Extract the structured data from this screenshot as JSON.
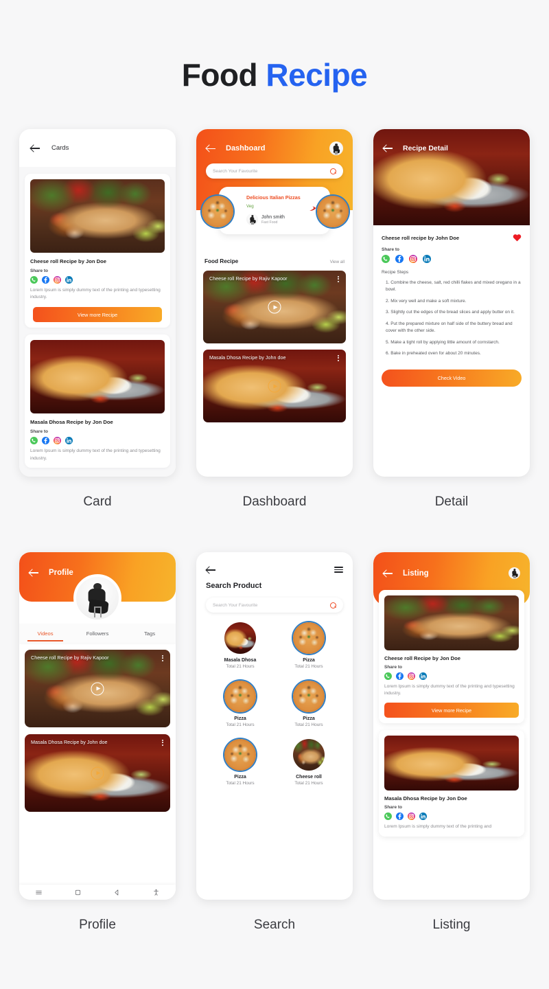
{
  "header": {
    "title_dark": "Food",
    "title_accent": "Recipe",
    "accent_color": "#2563f0"
  },
  "common": {
    "share_label": "Share to",
    "lorem": "Lorem Ipsum is simply dummy text of the printing and typesetting industry.",
    "view_more": "View more Recipe",
    "socials": [
      "whatsapp-icon",
      "facebook-icon",
      "instagram-icon",
      "linkedin-icon"
    ]
  },
  "screens": [
    {
      "caption": "Card",
      "title": "Cards",
      "cards": [
        {
          "title": "Cheese roll Recipe by Jon Doe",
          "share_label": "Share to",
          "text": "Lorem Ipsum is simply dummy text of the printing and typesetting industry.",
          "cta": "View more Recipe"
        },
        {
          "title": "Masala Dhosa Recipe by Jon Doe",
          "share_label": "Share to",
          "text": "Lorem Ipsum is simply dummy text of the printing and typesetting industry."
        }
      ]
    },
    {
      "caption": "Dashboard",
      "title": "Dashboard",
      "search_placeholder": "Search Your Favourite",
      "promo": {
        "title": "Delicious Italian Pizzas",
        "veg": "Veg",
        "chef_name": "John smith",
        "chef_role": "Fast Food"
      },
      "section": {
        "heading": "Food Recipe",
        "view_all": "View all"
      },
      "videos": [
        {
          "title": "Cheese roll Recipe by Rajiv Kapoor"
        },
        {
          "title": "Masala Dhosa Recipe by John doe"
        }
      ]
    },
    {
      "caption": "Detail",
      "title": "Recipe Detail",
      "recipe_title": "Cheese roll recipe by John Doe",
      "share_label": "Share to",
      "steps_label": "Recipe Steps",
      "steps": [
        "1. Combine the cheese, salt, red chilli flakes and mixed oregano in a bowl.",
        "2. Mix very well and make a soft mixture.",
        "3. Slightly cut the edges of the bread slices and apply butter on it.",
        "4. Put the prepared mixture on half side of the buttery bread and cover with the other side.",
        "5. Make a tight roll by applying little amount of cornstarch.",
        "6. Bake in preheated oven for about 20 minutes."
      ],
      "cta": "Check Video"
    },
    {
      "caption": "Profile",
      "title": "Profile",
      "tabs": [
        {
          "label": "Videos",
          "active": true
        },
        {
          "label": "Followers",
          "active": false
        },
        {
          "label": "Tags",
          "active": false
        }
      ],
      "videos": [
        {
          "title": "Cheese roll Recipe by Rajiv Kapoor"
        },
        {
          "title": "Masala Dhosa Recipe by John doe"
        }
      ],
      "nav": [
        "menu-icon",
        "square-icon",
        "back-triangle-icon",
        "accessibility-icon"
      ]
    },
    {
      "caption": "Search",
      "heading": "Search Product",
      "search_placeholder": "Search Your Favourite",
      "menu_icon": "hamburger-icon",
      "items": [
        {
          "name": "Masala Dhosa",
          "sub": "Total 21 Hours",
          "thumb": "dhosa"
        },
        {
          "name": "Pizza",
          "sub": "Total 21 Hours",
          "thumb": "pizza"
        },
        {
          "name": "Pizza",
          "sub": "Total 21 Hours",
          "thumb": "pizza"
        },
        {
          "name": "Pizza",
          "sub": "Total 21 Hours",
          "thumb": "pizza"
        },
        {
          "name": "Pizza",
          "sub": "Total 21 Hours",
          "thumb": "pizza"
        },
        {
          "name": "Cheese roll",
          "sub": "Total 21 Hours",
          "thumb": "wrap"
        }
      ]
    },
    {
      "caption": "Listing",
      "title": "Listing",
      "cards": [
        {
          "title": "Cheese roll Recipe by Jon Doe",
          "share_label": "Share to",
          "text": "Lorem Ipsum is simply dummy text of the printing and typesetting industry.",
          "cta": "View more Recipe"
        },
        {
          "title": "Masala Dhosa Recipe by Jon Doe",
          "share_label": "Share to",
          "text": "Lorem Ipsum is simply dummy text of the printing and"
        }
      ]
    }
  ]
}
